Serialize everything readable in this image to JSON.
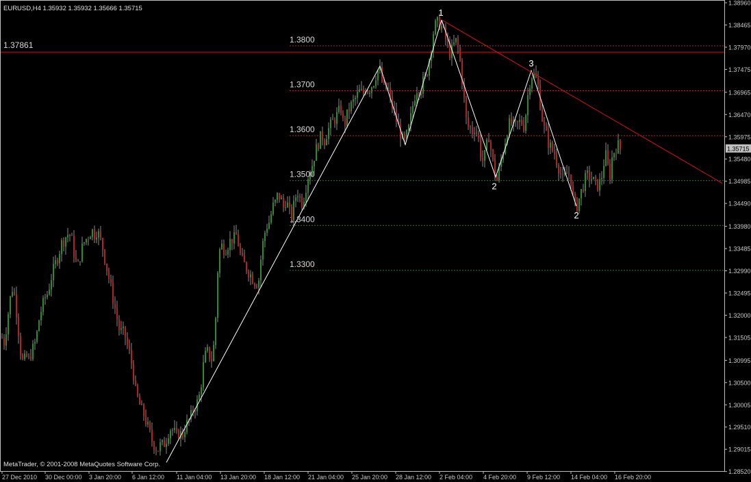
{
  "header": {
    "symbol_info": "EURUSD,H4  1.35932 1.35932 1.35666 1.35715"
  },
  "footer": {
    "copyright": "MetaTrader, © 2001-2008 MetaQuotes Software Corp."
  },
  "colors": {
    "background": "#000000",
    "frame": "#c0c0c0",
    "bull_candle": "#2e8b2e",
    "bear_candle": "#b22222",
    "wick": "#8a8a8a",
    "red_line": "#d01010",
    "red_dotted": "#a03030",
    "green_dotted": "#2e7d2e",
    "white_line": "#ffffff",
    "axis_text": "#c8c8c8",
    "price_tag_bg": "#c0c0c0",
    "price_tag_text": "#000000"
  },
  "chart_data": {
    "type": "candlestick",
    "symbol": "EURUSD",
    "timeframe": "H4",
    "ylim": [
      1.2853,
      1.3896
    ],
    "y_ticks": [
      "1.38960",
      "1.38465",
      "1.37970",
      "1.37475",
      "1.36965",
      "1.36470",
      "1.35975",
      "1.35480",
      "1.34985",
      "1.34490",
      "1.33980",
      "1.33485",
      "1.32990",
      "1.32495",
      "1.32000",
      "1.31505",
      "1.30995",
      "1.30500",
      "1.30005",
      "1.29510",
      "1.29015",
      "1.28520"
    ],
    "x_ticks": [
      "27 Dec 2010",
      "30 Dec 00:00",
      "3 Jan 20:00",
      "6 Jan 12:00",
      "11 Jan 04:00",
      "13 Jan 20:00",
      "18 Jan 12:00",
      "21 Jan 04:00",
      "25 Jan 20:00",
      "28 Jan 12:00",
      "2 Feb 04:00",
      "4 Feb 20:00",
      "9 Feb 12:00",
      "14 Feb 04:00",
      "16 Feb 20:00"
    ],
    "current_price": "1.35715",
    "horizontal_line": {
      "price": 1.37861,
      "label": "1.37861"
    },
    "levels": [
      {
        "price": 1.38,
        "label": "1.3800",
        "style": "red"
      },
      {
        "price": 1.37,
        "label": "1.3700",
        "style": "red"
      },
      {
        "price": 1.36,
        "label": "1.3600",
        "style": "red"
      },
      {
        "price": 1.35,
        "label": "1.3500",
        "style": "green"
      },
      {
        "price": 1.34,
        "label": "1.3400",
        "style": "green"
      },
      {
        "price": 1.33,
        "label": "1.3300",
        "style": "green"
      }
    ],
    "close_path": [
      [
        0,
        1.316
      ],
      [
        6,
        1.314
      ],
      [
        10,
        1.318
      ],
      [
        14,
        1.323
      ],
      [
        18,
        1.326
      ],
      [
        22,
        1.324
      ],
      [
        26,
        1.318
      ],
      [
        30,
        1.312
      ],
      [
        34,
        1.309
      ],
      [
        38,
        1.311
      ],
      [
        42,
        1.31
      ],
      [
        46,
        1.312
      ],
      [
        50,
        1.313
      ],
      [
        54,
        1.316
      ],
      [
        58,
        1.32
      ],
      [
        62,
        1.322
      ],
      [
        66,
        1.324
      ],
      [
        70,
        1.325
      ],
      [
        74,
        1.328
      ],
      [
        78,
        1.33
      ],
      [
        82,
        1.332
      ],
      [
        86,
        1.334
      ],
      [
        90,
        1.336
      ],
      [
        94,
        1.337
      ],
      [
        98,
        1.338
      ],
      [
        102,
        1.338
      ],
      [
        106,
        1.336
      ],
      [
        110,
        1.332
      ],
      [
        114,
        1.331
      ],
      [
        118,
        1.334
      ],
      [
        122,
        1.336
      ],
      [
        126,
        1.337
      ],
      [
        130,
        1.338
      ],
      [
        134,
        1.339
      ],
      [
        138,
        1.338
      ],
      [
        142,
        1.339
      ],
      [
        146,
        1.337
      ],
      [
        150,
        1.335
      ],
      [
        154,
        1.332
      ],
      [
        158,
        1.329
      ],
      [
        162,
        1.326
      ],
      [
        166,
        1.323
      ],
      [
        170,
        1.32
      ],
      [
        174,
        1.317
      ],
      [
        178,
        1.316
      ],
      [
        182,
        1.316
      ],
      [
        186,
        1.313
      ],
      [
        190,
        1.311
      ],
      [
        194,
        1.308
      ],
      [
        198,
        1.303
      ],
      [
        202,
        1.301
      ],
      [
        206,
        1.299
      ],
      [
        210,
        1.298
      ],
      [
        214,
        1.296
      ],
      [
        218,
        1.294
      ],
      [
        222,
        1.292
      ],
      [
        226,
        1.291
      ],
      [
        230,
        1.29
      ],
      [
        234,
        1.291
      ],
      [
        238,
        1.291
      ],
      [
        242,
        1.292
      ],
      [
        246,
        1.294
      ],
      [
        250,
        1.295
      ],
      [
        254,
        1.294
      ],
      [
        258,
        1.293
      ],
      [
        262,
        1.294
      ],
      [
        266,
        1.293
      ],
      [
        270,
        1.295
      ],
      [
        274,
        1.296
      ],
      [
        278,
        1.297
      ],
      [
        282,
        1.299
      ],
      [
        286,
        1.3
      ],
      [
        290,
        1.301
      ],
      [
        294,
        1.305
      ],
      [
        298,
        1.31
      ],
      [
        302,
        1.312
      ],
      [
        306,
        1.311
      ],
      [
        310,
        1.31
      ],
      [
        314,
        1.316
      ],
      [
        318,
        1.33
      ],
      [
        322,
        1.336
      ],
      [
        326,
        1.335
      ],
      [
        330,
        1.335
      ],
      [
        334,
        1.336
      ],
      [
        338,
        1.337
      ],
      [
        342,
        1.337
      ],
      [
        346,
        1.338
      ],
      [
        350,
        1.334
      ],
      [
        354,
        1.332
      ],
      [
        358,
        1.331
      ],
      [
        362,
        1.33
      ],
      [
        366,
        1.329
      ],
      [
        370,
        1.328
      ],
      [
        374,
        1.327
      ],
      [
        378,
        1.328
      ],
      [
        382,
        1.334
      ],
      [
        386,
        1.338
      ],
      [
        390,
        1.34
      ],
      [
        394,
        1.341
      ],
      [
        398,
        1.344
      ],
      [
        402,
        1.345
      ],
      [
        406,
        1.347
      ],
      [
        410,
        1.346
      ],
      [
        414,
        1.344
      ],
      [
        418,
        1.346
      ],
      [
        422,
        1.343
      ],
      [
        426,
        1.342
      ],
      [
        430,
        1.345
      ],
      [
        434,
        1.348
      ],
      [
        438,
        1.346
      ],
      [
        442,
        1.345
      ],
      [
        446,
        1.348
      ],
      [
        450,
        1.351
      ],
      [
        454,
        1.352
      ],
      [
        458,
        1.355
      ],
      [
        462,
        1.357
      ],
      [
        466,
        1.359
      ],
      [
        470,
        1.36
      ],
      [
        474,
        1.359
      ],
      [
        478,
        1.361
      ],
      [
        482,
        1.362
      ],
      [
        486,
        1.363
      ],
      [
        490,
        1.364
      ],
      [
        494,
        1.365
      ],
      [
        498,
        1.366
      ],
      [
        502,
        1.362
      ],
      [
        506,
        1.364
      ],
      [
        510,
        1.366
      ],
      [
        514,
        1.367
      ],
      [
        518,
        1.368
      ],
      [
        522,
        1.369
      ],
      [
        526,
        1.37
      ],
      [
        530,
        1.369
      ],
      [
        534,
        1.371
      ],
      [
        538,
        1.37
      ],
      [
        542,
        1.371
      ],
      [
        546,
        1.372
      ],
      [
        550,
        1.374
      ],
      [
        554,
        1.375
      ],
      [
        558,
        1.372
      ],
      [
        562,
        1.37
      ],
      [
        566,
        1.371
      ],
      [
        570,
        1.368
      ],
      [
        574,
        1.366
      ],
      [
        578,
        1.364
      ],
      [
        582,
        1.362
      ],
      [
        586,
        1.36
      ],
      [
        590,
        1.358
      ],
      [
        594,
        1.36
      ],
      [
        598,
        1.362
      ],
      [
        602,
        1.366
      ],
      [
        606,
        1.369
      ],
      [
        610,
        1.371
      ],
      [
        614,
        1.37
      ],
      [
        618,
        1.372
      ],
      [
        622,
        1.373
      ],
      [
        626,
        1.376
      ],
      [
        630,
        1.38
      ],
      [
        634,
        1.384
      ],
      [
        638,
        1.385
      ],
      [
        642,
        1.385
      ],
      [
        646,
        1.384
      ],
      [
        650,
        1.382
      ],
      [
        654,
        1.38
      ],
      [
        658,
        1.378
      ],
      [
        662,
        1.38
      ],
      [
        666,
        1.381
      ],
      [
        670,
        1.379
      ],
      [
        674,
        1.374
      ],
      [
        678,
        1.368
      ],
      [
        682,
        1.362
      ],
      [
        686,
        1.362
      ],
      [
        690,
        1.361
      ],
      [
        694,
        1.362
      ],
      [
        698,
        1.36
      ],
      [
        702,
        1.356
      ],
      [
        706,
        1.354
      ],
      [
        710,
        1.357
      ],
      [
        714,
        1.36
      ],
      [
        718,
        1.356
      ],
      [
        722,
        1.352
      ],
      [
        726,
        1.35
      ],
      [
        730,
        1.353
      ],
      [
        734,
        1.356
      ],
      [
        738,
        1.359
      ],
      [
        742,
        1.362
      ],
      [
        746,
        1.363
      ],
      [
        750,
        1.362
      ],
      [
        754,
        1.362
      ],
      [
        758,
        1.363
      ],
      [
        762,
        1.363
      ],
      [
        766,
        1.362
      ],
      [
        770,
        1.368
      ],
      [
        774,
        1.372
      ],
      [
        778,
        1.374
      ],
      [
        782,
        1.373
      ],
      [
        786,
        1.371
      ],
      [
        790,
        1.366
      ],
      [
        794,
        1.362
      ],
      [
        798,
        1.36
      ],
      [
        802,
        1.358
      ],
      [
        806,
        1.357
      ],
      [
        810,
        1.356
      ],
      [
        814,
        1.354
      ],
      [
        818,
        1.352
      ],
      [
        822,
        1.35
      ],
      [
        826,
        1.351
      ],
      [
        830,
        1.352
      ],
      [
        834,
        1.35
      ],
      [
        838,
        1.345
      ],
      [
        842,
        1.344
      ],
      [
        846,
        1.346
      ],
      [
        850,
        1.348
      ],
      [
        854,
        1.35
      ],
      [
        858,
        1.351
      ],
      [
        862,
        1.351
      ],
      [
        866,
        1.35
      ],
      [
        870,
        1.349
      ],
      [
        874,
        1.349
      ],
      [
        878,
        1.35
      ],
      [
        882,
        1.354
      ],
      [
        886,
        1.356
      ],
      [
        890,
        1.35
      ],
      [
        894,
        1.355
      ],
      [
        898,
        1.357
      ],
      [
        902,
        1.358
      ],
      [
        906,
        1.357
      ]
    ],
    "wave_labels": [
      {
        "text": "1",
        "x": 644,
        "price": 1.3858
      },
      {
        "text": "3",
        "x": 776,
        "price": 1.3745
      },
      {
        "text": "2",
        "x": 722,
        "price": 1.3508
      },
      {
        "text": "2",
        "x": 842,
        "price": 1.3443
      }
    ],
    "wave_lines": [
      [
        [
          243,
          1.2872
        ],
        [
          555,
          1.3755
        ],
        [
          592,
          1.358
        ],
        [
          645,
          1.3858
        ]
      ],
      [
        [
          645,
          1.3858
        ],
        [
          724,
          1.3508
        ],
        [
          776,
          1.3745
        ],
        [
          842,
          1.3443
        ]
      ]
    ],
    "trend_line": [
      [
        645,
        1.3858
      ],
      [
        1055,
        1.3494
      ]
    ]
  }
}
